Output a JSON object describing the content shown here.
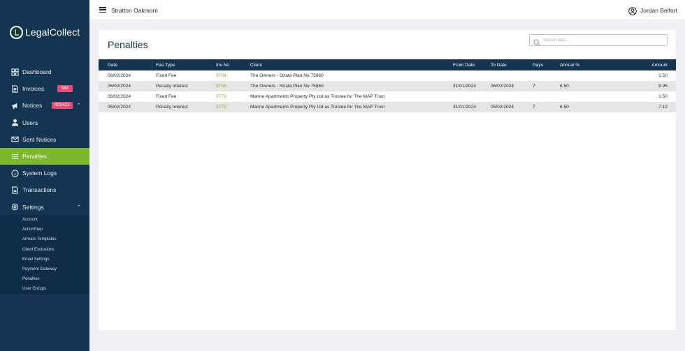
{
  "app": {
    "logo_text": "LegalCollect",
    "organization": "Stratton Oakmont",
    "user_name": "Jordan Belfort"
  },
  "sidebar": {
    "items": [
      {
        "label": "Dashboard",
        "icon": "dashboard-icon"
      },
      {
        "label": "Invoices",
        "icon": "invoice-icon",
        "badge": "584"
      },
      {
        "label": "Notices",
        "icon": "notices-icon",
        "badge": "401/422"
      },
      {
        "label": "Users",
        "icon": "user-icon"
      },
      {
        "label": "Sent Notices",
        "icon": "mail-icon"
      },
      {
        "label": "Penalties",
        "icon": "list-icon",
        "active": true
      },
      {
        "label": "System Logs",
        "icon": "info-icon"
      },
      {
        "label": "Transactions",
        "icon": "document-icon"
      },
      {
        "label": "Settings",
        "icon": "gear-icon"
      }
    ],
    "settings_subitems": [
      "Account",
      "ActionStep",
      "Arrears Templates",
      "Client Exclusions",
      "Email Settings",
      "Payment Gateway",
      "Penalties",
      "User Groups"
    ]
  },
  "page": {
    "title": "Penalties",
    "search_placeholder": "Search data..."
  },
  "table": {
    "headers": {
      "date": "Date",
      "fee_type": "Fee Type",
      "inv_no": "Inv No",
      "client": "Client",
      "from_date": "From Date",
      "to_date": "To Date",
      "days": "Days",
      "annual": "Annual %",
      "amount": "Amount"
    },
    "rows": [
      {
        "date": "06/02/2024",
        "fee_type": "Fixed Fee",
        "inv_no": "9764",
        "client": "The Owners - Strata Plan No 75860",
        "from_date": "",
        "to_date": "",
        "days": "",
        "annual": "",
        "amount": "1.50"
      },
      {
        "date": "06/02/2024",
        "fee_type": "Penalty Interest",
        "inv_no": "9764",
        "client": "The Owners - Strata Plan No 75860",
        "from_date": "31/01/2024",
        "to_date": "06/02/2024",
        "days": "7",
        "annual": "6.50",
        "amount": "8.95"
      },
      {
        "date": "06/02/2024",
        "fee_type": "Fixed Fee",
        "inv_no": "9773",
        "client": "Marine Apartments Property Pty Ltd as Trustee for The MAP Trust",
        "from_date": "",
        "to_date": "",
        "days": "",
        "annual": "",
        "amount": "1.50"
      },
      {
        "date": "05/02/2024",
        "fee_type": "Penalty Interest",
        "inv_no": "9773",
        "client": "Marine Apartments Property Pty Ltd as Trustee for The MAP Trust",
        "from_date": "31/01/2024",
        "to_date": "05/02/2024",
        "days": "7",
        "annual": "6.50",
        "amount": "7.12"
      }
    ]
  },
  "colors": {
    "sidebar_bg": "#133552",
    "accent_green": "#7cb72d",
    "badge_pink": "#ec4b78"
  }
}
